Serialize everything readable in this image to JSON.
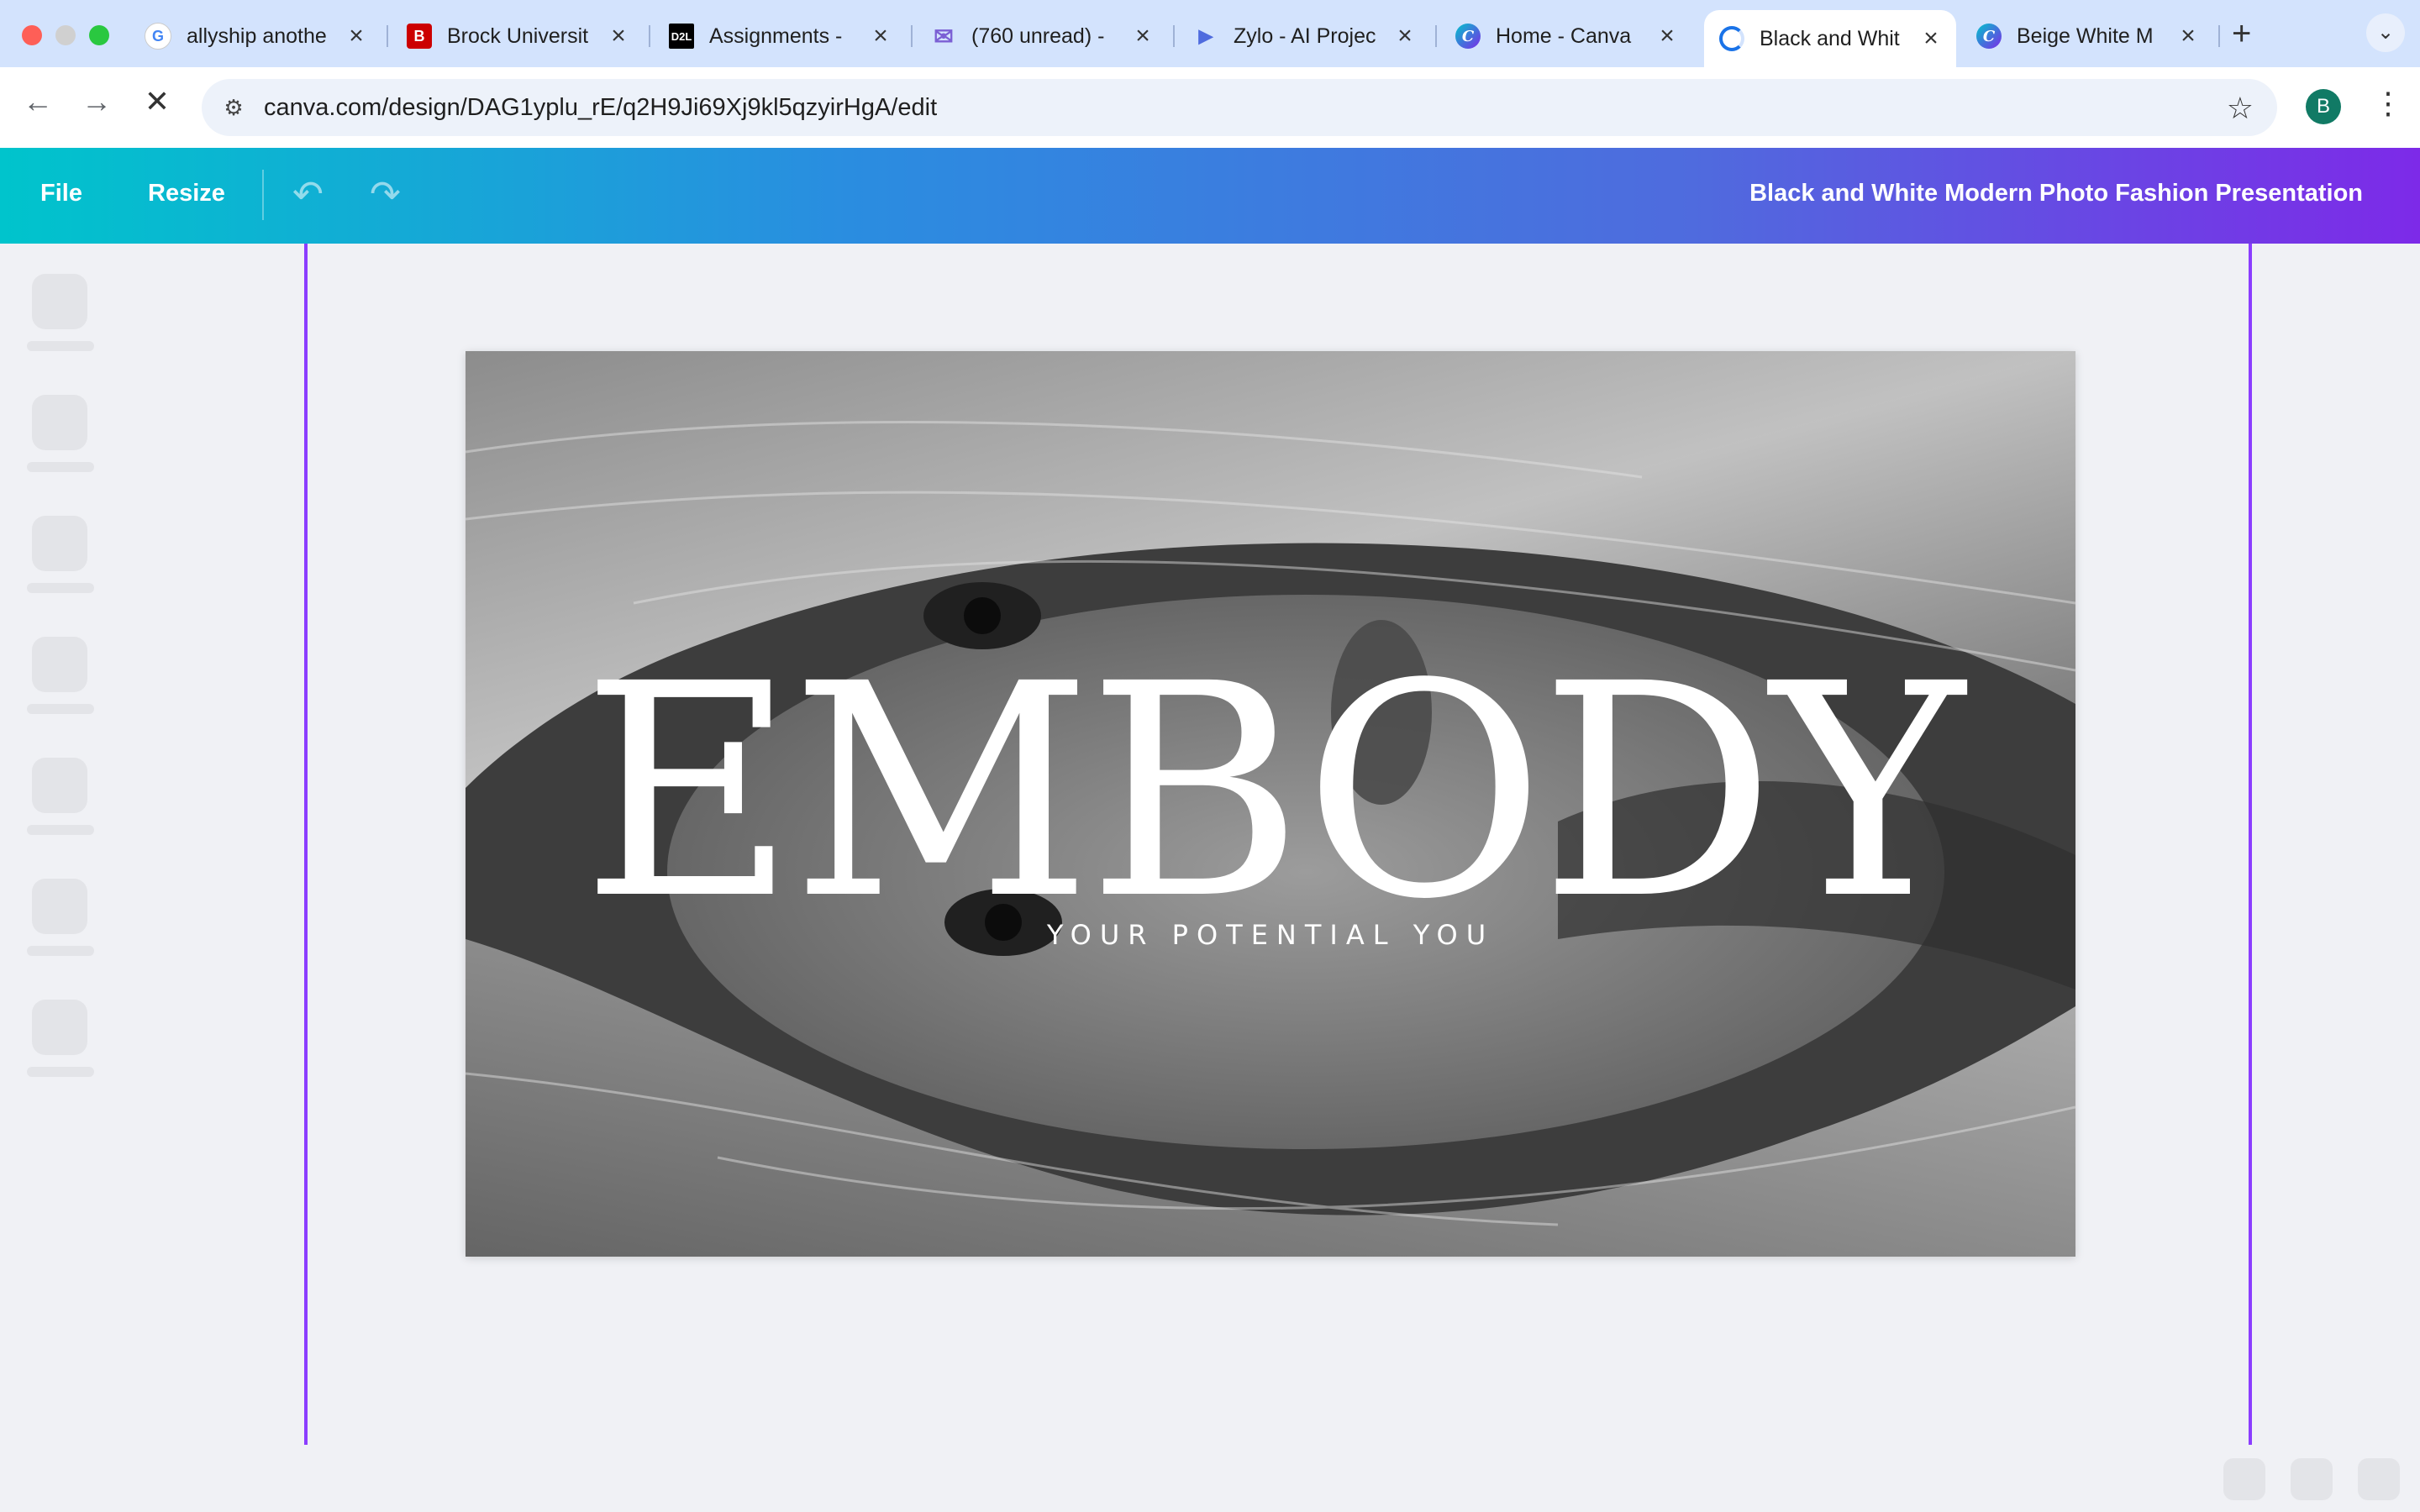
{
  "browser": {
    "tabs": [
      {
        "title": "allyship anothe",
        "favicon": "google-icon",
        "active": false
      },
      {
        "title": "Brock Universit",
        "favicon": "brock-b-icon",
        "active": false
      },
      {
        "title": "Assignments -",
        "favicon": "d2l-icon",
        "active": false
      },
      {
        "title": "(760 unread) -",
        "favicon": "mail-icon",
        "active": false
      },
      {
        "title": "Zylo - AI Projec",
        "favicon": "zylo-play-icon",
        "active": false
      },
      {
        "title": "Home - Canva",
        "favicon": "canva-icon",
        "active": false
      },
      {
        "title": "Black and Whit",
        "favicon": "loading-icon",
        "active": true
      },
      {
        "title": "Beige White M",
        "favicon": "canva-icon",
        "active": false
      }
    ],
    "url": "canva.com/design/DAG1yplu_rE/q2H9Ji69Xj9kl5qzyirHgA/edit",
    "profile_initial": "B"
  },
  "canva": {
    "file_label": "File",
    "resize_label": "Resize",
    "document_title": "Black and White Modern Photo Fashion Presentation"
  },
  "slide": {
    "headline": "EMBODY",
    "subheadline": "YOUR POTENTIAL YOU"
  },
  "colors": {
    "tabstrip": "#d3e3fd",
    "canva_gradient_start": "#00c4cc",
    "canva_gradient_end": "#7d2ae8",
    "guide": "#8b3dff"
  }
}
